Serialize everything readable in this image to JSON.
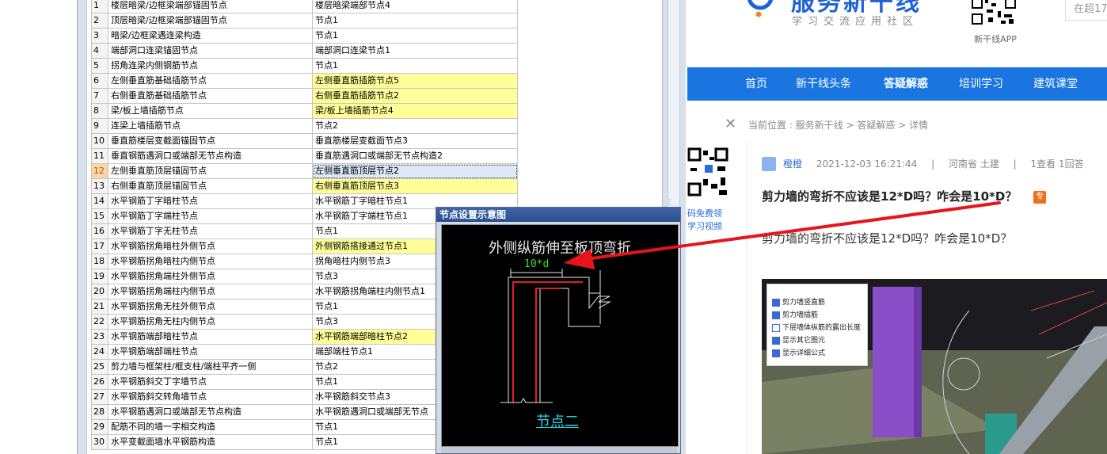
{
  "table": {
    "rows": [
      {
        "num": "1",
        "name": "楼层暗梁/边框梁端部锚固节点",
        "value": "楼层暗梁端部节点4",
        "hl": false
      },
      {
        "num": "2",
        "name": "顶层暗梁/边框梁端部锚固节点",
        "value": "节点1",
        "hl": false
      },
      {
        "num": "3",
        "name": "暗梁/边框梁遇连梁构造",
        "value": "节点1",
        "hl": false
      },
      {
        "num": "4",
        "name": "端部洞口连梁锚固节点",
        "value": "端部洞口连梁节点1",
        "hl": false
      },
      {
        "num": "5",
        "name": "拐角连梁内侧钢筋节点",
        "value": "节点1",
        "hl": false
      },
      {
        "num": "6",
        "name": "左侧垂直筋基础插筋节点",
        "value": "左侧垂直筋插筋节点5",
        "hl": true
      },
      {
        "num": "7",
        "name": "右侧垂直筋基础插筋节点",
        "value": "右侧垂直筋插筋节点2",
        "hl": true
      },
      {
        "num": "8",
        "name": "梁/板上墙插筋节点",
        "value": "梁/板上墙插筋节点4",
        "hl": true
      },
      {
        "num": "9",
        "name": "连梁上墙插筋节点",
        "value": "节点2",
        "hl": false
      },
      {
        "num": "10",
        "name": "垂直筋楼层变截面锚固节点",
        "value": "垂直筋楼层变截面节点3",
        "hl": false
      },
      {
        "num": "11",
        "name": "垂直钢筋遇洞口或端部无节点构造",
        "value": "垂直筋遇洞口或端部无节点构造2",
        "hl": false
      },
      {
        "num": "12",
        "name": "左侧垂直筋顶层锚固节点",
        "value": "左侧垂直筋顶层节点2",
        "hl": false,
        "sel": true
      },
      {
        "num": "13",
        "name": "右侧垂直筋顶层锚固节点",
        "value": "右侧垂直筋顶层节点3",
        "hl": true
      },
      {
        "num": "14",
        "name": "水平钢筋丁字暗柱节点",
        "value": "水平钢筋丁字暗柱节点1",
        "hl": false
      },
      {
        "num": "15",
        "name": "水平钢筋丁字端柱节点",
        "value": "水平钢筋丁字端柱节点1",
        "hl": false
      },
      {
        "num": "16",
        "name": "水平钢筋丁字无柱节点",
        "value": "节点1",
        "hl": false
      },
      {
        "num": "17",
        "name": "水平钢筋拐角暗柱外侧节点",
        "value": "外侧钢筋搭接通过节点1",
        "hl": true
      },
      {
        "num": "18",
        "name": "水平钢筋拐角暗柱内侧节点",
        "value": "拐角暗柱内侧节点3",
        "hl": false
      },
      {
        "num": "19",
        "name": "水平钢筋拐角端柱外侧节点",
        "value": "节点3",
        "hl": false
      },
      {
        "num": "20",
        "name": "水平钢筋拐角端柱内侧节点",
        "value": "水平钢筋拐角端柱内侧节点1",
        "hl": false
      },
      {
        "num": "21",
        "name": "水平钢筋拐角无柱外侧节点",
        "value": "节点1",
        "hl": false
      },
      {
        "num": "22",
        "name": "水平钢筋拐角无柱内侧节点",
        "value": "节点3",
        "hl": false
      },
      {
        "num": "23",
        "name": "水平钢筋端部暗柱节点",
        "value": "水平钢筋端部暗柱节点2",
        "hl": true
      },
      {
        "num": "24",
        "name": "水平钢筋端部端柱节点",
        "value": "端部端柱节点1",
        "hl": false
      },
      {
        "num": "25",
        "name": "剪力墙与框架柱/框支柱/端柱平齐一侧",
        "value": "节点2",
        "hl": false
      },
      {
        "num": "26",
        "name": "水平钢筋斜交丁字墙节点",
        "value": "节点1",
        "hl": false
      },
      {
        "num": "27",
        "name": "水平钢筋斜交转角墙节点",
        "value": "水平钢筋斜交节点3",
        "hl": false
      },
      {
        "num": "28",
        "name": "水平钢筋遇洞口或端部无节点构造",
        "value": "水平钢筋遇洞口或端部无节点",
        "hl": false
      },
      {
        "num": "29",
        "name": "配筋不同的墙一字相交构造",
        "value": "节点1",
        "hl": false
      },
      {
        "num": "30",
        "name": "水平变截面墙水平钢筋构造",
        "value": "节点1",
        "hl": false
      }
    ]
  },
  "dialog": {
    "title": "节点设置示意图",
    "canvas_title": "外侧纵筋伸至板顶弯折",
    "dim_label": "10*d",
    "node_label": "节点二"
  },
  "site": {
    "logo_main": "服务新干线",
    "logo_sub": "学习交流应用社区",
    "app_label": "新干线APP",
    "search_placeholder": "在超17",
    "nav": [
      "首页",
      "新干线头条",
      "答疑解惑",
      "培训学习",
      "建筑课堂"
    ],
    "breadcrumb": "当前位置 : 服务新干线 > 答疑解惑 > 详情",
    "side_text_1": "码免费领",
    "side_text_2": "学习视频",
    "meta_user": "橙橙",
    "meta_time": "2021-12-03 16:21:44",
    "meta_loc": "河南省  土建",
    "meta_stats": "1查看  1回答",
    "question_title": "剪力墙的弯折不应该是12*D吗？咋会是10*D？",
    "tag": "专",
    "question_body": "剪力墙的弯折不应该是12*D吗？咋会是10*D？",
    "panel_items": [
      {
        "label": "剪力墙竖直筋",
        "checked": true
      },
      {
        "label": "剪力墙插筋",
        "checked": true
      },
      {
        "label": "下层墙体纵筋的露出长度",
        "checked": false
      },
      {
        "label": "显示其它图元",
        "checked": true
      },
      {
        "label": "显示详细公式",
        "checked": true
      }
    ]
  },
  "colors": {
    "nav_bg": "#1a75e0",
    "annotation_arrow": "#e8141c",
    "highlight_row": "#ffff99",
    "dialog_title_bg": "#2a4e90"
  }
}
